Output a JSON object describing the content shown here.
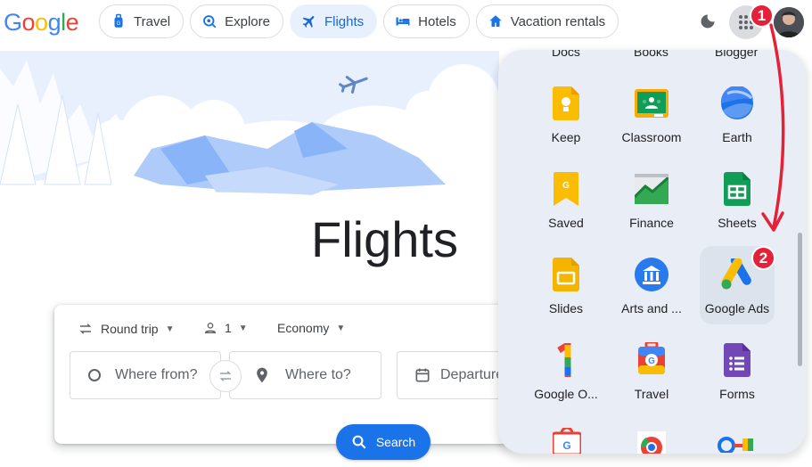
{
  "logo": {
    "letters": [
      "G",
      "o",
      "o",
      "g",
      "l",
      "e"
    ],
    "colors": [
      "#4285f4",
      "#ea4335",
      "#fbbc05",
      "#4285f4",
      "#34a853",
      "#ea4335"
    ]
  },
  "nav": {
    "tabs": [
      {
        "label": "Travel",
        "icon": "travel-bag-icon"
      },
      {
        "label": "Explore",
        "icon": "explore-icon"
      },
      {
        "label": "Flights",
        "icon": "plane-icon"
      },
      {
        "label": "Hotels",
        "icon": "bed-icon"
      },
      {
        "label": "Vacation rentals",
        "icon": "house-icon"
      }
    ]
  },
  "header": {
    "badge_one": "1",
    "badge_two": "2"
  },
  "hero": {
    "title": "Flights"
  },
  "search": {
    "trip_type": "Round trip",
    "passengers": "1",
    "cabin_class": "Economy",
    "from_placeholder": "Where from?",
    "to_placeholder": "Where to?",
    "departure_placeholder": "Departure",
    "search_label": "Search"
  },
  "apps_panel": {
    "top_row": [
      "Docs",
      "Books",
      "Blogger"
    ],
    "apps": [
      {
        "label": "Keep",
        "icon": "keep-icon"
      },
      {
        "label": "Classroom",
        "icon": "classroom-icon"
      },
      {
        "label": "Earth",
        "icon": "earth-icon"
      },
      {
        "label": "Saved",
        "icon": "saved-icon"
      },
      {
        "label": "Finance",
        "icon": "finance-icon"
      },
      {
        "label": "Sheets",
        "icon": "sheets-icon"
      },
      {
        "label": "Slides",
        "icon": "slides-icon"
      },
      {
        "label": "Arts and ...",
        "icon": "arts-culture-icon"
      },
      {
        "label": "Google Ads",
        "icon": "google-ads-icon"
      },
      {
        "label": "Google O...",
        "icon": "google-one-icon"
      },
      {
        "label": "Travel",
        "icon": "travel-icon"
      },
      {
        "label": "Forms",
        "icon": "forms-icon"
      }
    ]
  },
  "colors": {
    "accent": "#1a73e8",
    "badge": "#e5213a",
    "panel": "#e9eef6",
    "active_tab": "#e8f0fe"
  }
}
